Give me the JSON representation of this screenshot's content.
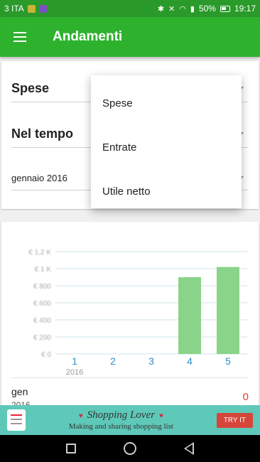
{
  "status_bar": {
    "carrier": "3 ITA",
    "battery": "50%",
    "time": "19:17",
    "icons": [
      "notification-yellow-icon",
      "notification-purple-icon",
      "bluetooth-icon",
      "mute-icon",
      "wifi-icon",
      "signal-icon",
      "battery-icon"
    ]
  },
  "app_bar": {
    "title": "Andamenti",
    "menu_icon": "hamburger-menu-icon"
  },
  "filters": {
    "type_value": "Spese",
    "period_value": "Nel tempo",
    "month_value": "gennaio 2016"
  },
  "dropdown": {
    "options": [
      "Spese",
      "Entrate",
      "Utile netto"
    ]
  },
  "chart_data": {
    "type": "bar",
    "categories": [
      "1",
      "2",
      "3",
      "4",
      "5"
    ],
    "x_sublabel": "2016",
    "values": [
      0,
      0,
      0,
      900,
      1020
    ],
    "y_ticks": [
      "€ 1,2 K",
      "€ 1 K",
      "€ 800",
      "€ 600",
      "€ 400",
      "€ 200",
      "€ 0"
    ],
    "ylim": [
      0,
      1200
    ],
    "grid": true,
    "bar_color": "#8ad48a"
  },
  "summary_row": {
    "label": "gen",
    "sublabel": "2016",
    "value": "0"
  },
  "ad": {
    "title": "Shopping Lover",
    "subtitle": "Making and sharing shopping list",
    "cta": "TRY IT"
  },
  "colors": {
    "status_bar": "#2a9a2a",
    "app_bar": "#2eb22e",
    "negative_value": "#e53935",
    "axis_label": "#2b8ec9"
  }
}
